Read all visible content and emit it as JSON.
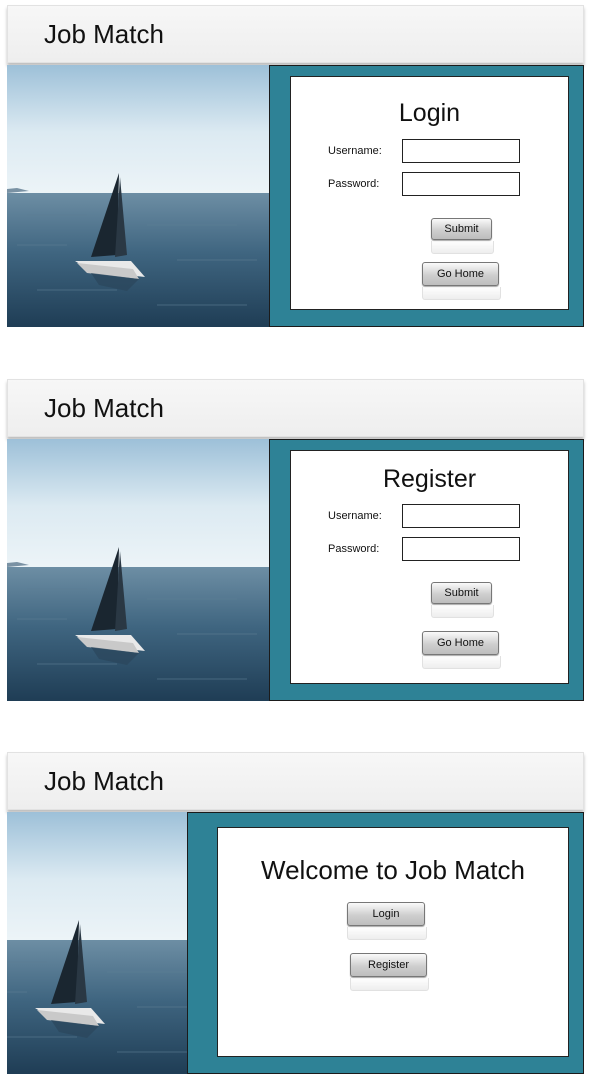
{
  "app_title": "Job Match",
  "login": {
    "title": "Login",
    "username_label": "Username:",
    "password_label": "Password:",
    "username_value": "",
    "password_value": "",
    "submit_label": "Submit",
    "home_label": "Go Home"
  },
  "register": {
    "title": "Register",
    "username_label": "Username:",
    "password_label": "Password:",
    "username_value": "",
    "password_value": "",
    "submit_label": "Submit",
    "home_label": "Go Home"
  },
  "welcome": {
    "title": "Welcome to Job Match",
    "login_label": "Login",
    "register_label": "Register"
  },
  "colors": {
    "panel_border": "#2e8296",
    "header_bg": "#f3f3f3"
  }
}
